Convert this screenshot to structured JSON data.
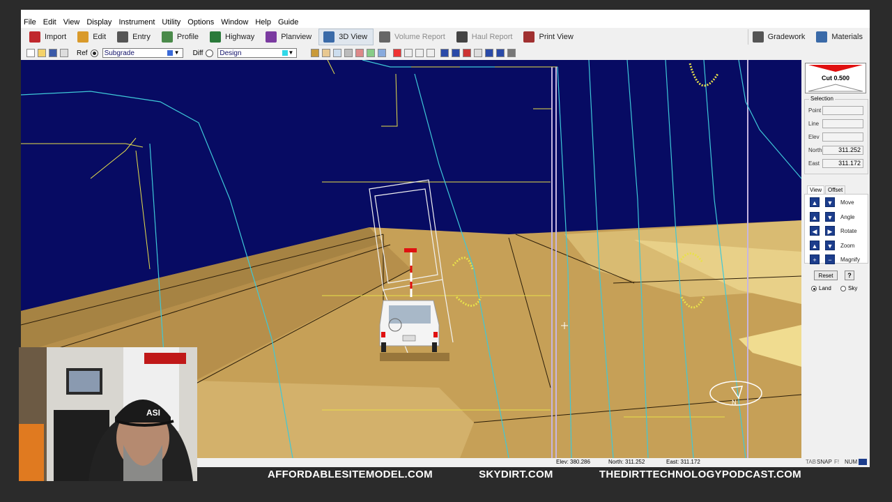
{
  "menu": [
    "File",
    "Edit",
    "View",
    "Display",
    "Instrument",
    "Utility",
    "Options",
    "Window",
    "Help",
    "Guide"
  ],
  "toolbar": {
    "buttons": [
      {
        "label": "Import",
        "icon": "import-icon",
        "color": "#c0282d"
      },
      {
        "label": "Edit",
        "icon": "pencil-icon",
        "color": "#d99a2b"
      },
      {
        "label": "Entry",
        "icon": "crosshair-icon",
        "color": "#555555"
      },
      {
        "label": "Profile",
        "icon": "profile-chart-icon",
        "color": "#4a8a4a"
      },
      {
        "label": "Highway",
        "icon": "highway-icon",
        "color": "#2a7a3a"
      },
      {
        "label": "Planview",
        "icon": "planview-icon",
        "color": "#7a3aa0"
      },
      {
        "label": "3D View",
        "icon": "3d-view-icon",
        "color": "#3a6aa8"
      },
      {
        "label": "Volume Report",
        "icon": "volume-report-icon",
        "color": "#666666"
      },
      {
        "label": "Haul Report",
        "icon": "haul-report-icon",
        "color": "#444444"
      },
      {
        "label": "Print View",
        "icon": "print-icon",
        "color": "#a03030"
      }
    ],
    "active": "3D View",
    "disabled": [
      "Volume Report",
      "Haul Report"
    ],
    "right_buttons": [
      {
        "label": "Gradework",
        "icon": "gradework-icon",
        "color": "#555555"
      },
      {
        "label": "Materials",
        "icon": "materials-icon",
        "color": "#3a6aa8"
      }
    ]
  },
  "surface_bar": {
    "ref_label": "Ref",
    "ref_value": "Subgrade",
    "ref_color": "#3a6ad8",
    "diff_label": "Diff",
    "diff_value": "Design",
    "diff_color": "#30d8e8"
  },
  "side_panel": {
    "cut_label": "Cut 0.500",
    "selection_title": "Selection",
    "fields": [
      {
        "label": "Point",
        "value": ""
      },
      {
        "label": "Line",
        "value": ""
      },
      {
        "label": "Elev",
        "value": ""
      },
      {
        "label": "North",
        "value": "311.252"
      },
      {
        "label": "East",
        "value": "311.172"
      }
    ],
    "tabs": [
      "View",
      "Offset"
    ],
    "controls": [
      "Move",
      "Angle",
      "Rotate",
      "Zoom",
      "Magnify"
    ],
    "reset_label": "Reset",
    "help_label": "?",
    "modes": [
      "Land",
      "Sky"
    ],
    "mode_selected": "Land"
  },
  "status": {
    "elev": "Elev: 380.286",
    "north": "North: 311.252",
    "east": "East: 311.172",
    "indicators": [
      "TAB",
      "SNAP",
      "F!",
      "NUM"
    ]
  },
  "banner": [
    "AFFORDABLESITEMODEL.COM",
    "SKYDIRT.COM",
    "THEDIRTTECHNOLOGYPODCAST.COM"
  ],
  "webcam": {
    "cap_text": "ASI"
  },
  "colors": {
    "sky": "#070b63",
    "ground": "#c6a057",
    "ground_dark": "#8e7035",
    "breakline": "#3ec8d8",
    "gridline": "#e8e04a",
    "accent_red": "#e01010"
  }
}
